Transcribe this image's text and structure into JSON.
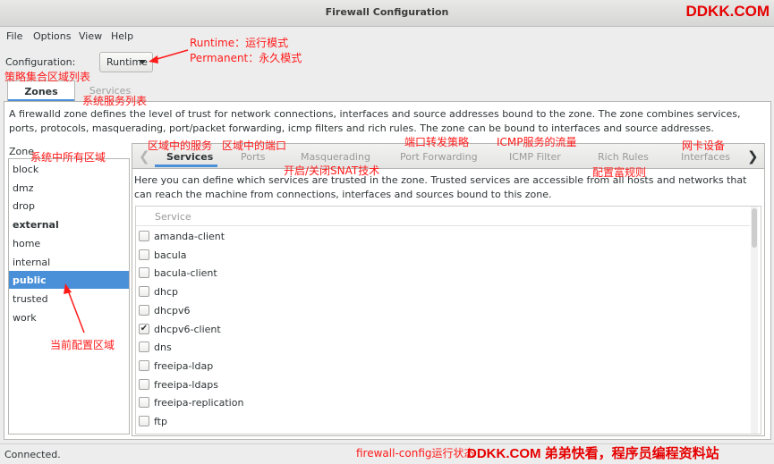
{
  "window": {
    "title": "Firewall Configuration"
  },
  "watermark": {
    "brand": "DDKK.COM",
    "bottom": "DDKK.COM 弟弟快看，程序员编程资料站"
  },
  "menubar": {
    "items": [
      "File",
      "Options",
      "View",
      "Help"
    ]
  },
  "config": {
    "label": "Configuration:",
    "value": "Runtime"
  },
  "main_tabs": {
    "zones": "Zones",
    "services": "Services"
  },
  "description": "A firewalld zone defines the level of trust for network connections, interfaces and source addresses bound to the zone. The zone combines services, ports, protocols, masquerading, port/packet forwarding, icmp filters and rich rules. The zone can be bound to interfaces and source addresses.",
  "zones": {
    "label": "Zone",
    "items": [
      "block",
      "dmz",
      "drop",
      "external",
      "home",
      "internal",
      "public",
      "trusted",
      "work"
    ],
    "selected": "public",
    "bold": [
      "external"
    ]
  },
  "subtabs": {
    "items": [
      "Services",
      "Ports",
      "Masquerading",
      "Port Forwarding",
      "ICMP Filter",
      "Rich Rules",
      "Interfaces"
    ],
    "active": "Services",
    "left_arrow": "❮",
    "right_arrow": "❯"
  },
  "services_panel": {
    "description": "Here you can define which services are trusted in the zone. Trusted services are accessible from all hosts and networks that can reach the machine from connections, interfaces and sources bound to this zone.",
    "header": "Service",
    "rows": [
      {
        "name": "amanda-client",
        "checked": false
      },
      {
        "name": "bacula",
        "checked": false
      },
      {
        "name": "bacula-client",
        "checked": false
      },
      {
        "name": "dhcp",
        "checked": false
      },
      {
        "name": "dhcpv6",
        "checked": false
      },
      {
        "name": "dhcpv6-client",
        "checked": true
      },
      {
        "name": "dns",
        "checked": false
      },
      {
        "name": "freeipa-ldap",
        "checked": false
      },
      {
        "name": "freeipa-ldaps",
        "checked": false
      },
      {
        "name": "freeipa-replication",
        "checked": false
      },
      {
        "name": "ftp",
        "checked": false
      }
    ]
  },
  "status": {
    "text": "Connected."
  },
  "annotations": {
    "runtime": "Runtime：运行模式",
    "permanent": "Permanent：永久模式",
    "policy_list": "策略集合区域列表",
    "service_list": "系统服务列表",
    "all_zones": "系统中所有区域",
    "zone_services": "区域中的服务",
    "zone_ports": "区域中的端口",
    "snat": "开启/关闭SNAT技术",
    "port_forward": "端口转发策略",
    "icmp": "ICMP服务的流量",
    "rich_rules": "配置富规则",
    "nic": "网卡设备",
    "current_zone": "当前配置区域",
    "status_note": "firewall-config运行状态"
  },
  "colors": {
    "accent": "#4a90d9",
    "annotation": "#ff1a1a",
    "watermark": "#e60000"
  }
}
